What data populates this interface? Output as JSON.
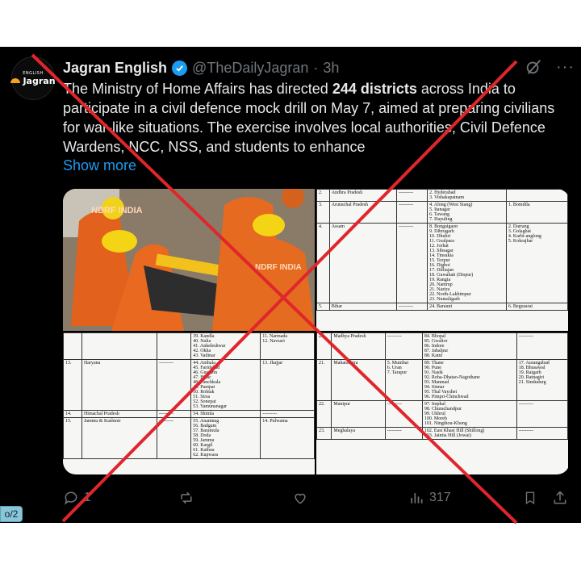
{
  "tweet": {
    "avatar": {
      "small": "ENGLISH",
      "brand": "Jagran"
    },
    "author_name": "Jagran English",
    "handle": "@TheDailyJagran",
    "separator": "·",
    "time": "3h",
    "text_parts": [
      "The Ministry of Home Affairs has directed ",
      "244 districts",
      " across India to participate in a civil defence mock drill on May 7, aimed at preparing civilians for war-like situations. The exercise involves local authorities, Civil Defence Wardens, NCC, NSS, and students to enhance"
    ],
    "show_more": "Show more"
  },
  "media": {
    "photo_labels": [
      "NDRF INDIA",
      "NDRF INDIA"
    ],
    "doc1_rows": [
      [
        "2.",
        "Andhra Pradesh",
        "---------",
        "2. Hyderabad\n3. Vishakapatnam",
        ""
      ],
      [
        "3.",
        "Arunachal Pradesh",
        "---------",
        "4. Along (West Siang)\n5. Itanagar\n6. Tawang\n7. Hayuling",
        "1. Bomdila"
      ],
      [
        "4.",
        "Assam",
        "---------",
        "8. Bongaigaon\n9. Dibrugarh\n10. Dhubri\n11. Goalpara\n12. Jorhat\n13. Sibsagar\n14. Tinsukia\n15. Tezpur\n16. Digboi\n17. Dilliajan\n18. Guwahati (Dispur)\n19. Rangia\n20. Namrup\n21. Nazira\n22. North-Lakhimpur\n23. Numaligarh",
        "2. Darrang\n3. Golaghat\n4. Karbi-anglong\n5. Kokrajhar"
      ],
      [
        "5.",
        "Bihar",
        "---------",
        "24. Barauni",
        "6. Begusarai"
      ]
    ],
    "doc2_rows": [
      [
        "",
        "",
        "",
        "39. Kandla\n40. Nalia\n41. Ankeleshwar\n42. Okha\n43. Vadinar",
        "11. Narmada\n12. Navsari"
      ],
      [
        "13.",
        "Haryana",
        "---------",
        "44. Ambala\n45. Faridabad\n46. Gurgaon\n47. Hisar\n48. Panchkula\n49. Panipat\n50. Rohtak\n51. Sirsa\n52. Sonepat\n53. Yamunanagar",
        "13. Jhajjar"
      ],
      [
        "14.",
        "Himachal Pradesh",
        "---------",
        "54. Shimla",
        "---------"
      ],
      [
        "15.",
        "Jammu & Kashmir",
        "---------",
        "55. Anantnag\n56. Badgam\n57. Baramula\n58. Doda\n59. Jammu\n60. Kargil\n61. Kathua\n62. Kupwara",
        "14. Pulwama"
      ]
    ],
    "doc3_rows": [
      [
        "20.",
        "Madhya Pradesh",
        "---------",
        "84. Bhopal\n85. Gwalior\n86. Indore\n87. Jabalpur\n88. Katni",
        "---------"
      ],
      [
        "21.",
        "Maharashtra",
        "5. Mumbai\n6. Uran\n7. Tarapur",
        "89. Thane\n90. Pune\n91. Nasik\n92. Roha-Dhatao-Nagothane\n93. Manmad\n94. Sinnar\n95. Thal Vayshet\n96. Pimpri-Chinchwad",
        "17. Aurangabad\n18. Bhusawal\n19. Raigarh\n20. Ratnagiri\n21. Sindudurg"
      ],
      [
        "22.",
        "Manipur",
        "---------",
        "97. Imphal\n98. Churachandpur\n99. Ukhrul\n100. Moreh\n101. Ningthou-Khong",
        "---------"
      ],
      [
        "23.",
        "Meghalaya",
        "---------",
        "102. East Khasi Hill (Shillong)\n103. Jaintia Hill (Jowai)",
        "---------"
      ]
    ]
  },
  "actions": {
    "reply_count": "1",
    "retweet_count": "",
    "like_count": "",
    "views_count": "317"
  },
  "overlay": {
    "page_indicator": "o/2",
    "cross_color": "#e0262b"
  },
  "colors": {
    "background": "#000000",
    "text": "#e7e9ea",
    "muted": "#71767b",
    "link": "#1d9bf0",
    "verified": "#1d9bf0"
  }
}
